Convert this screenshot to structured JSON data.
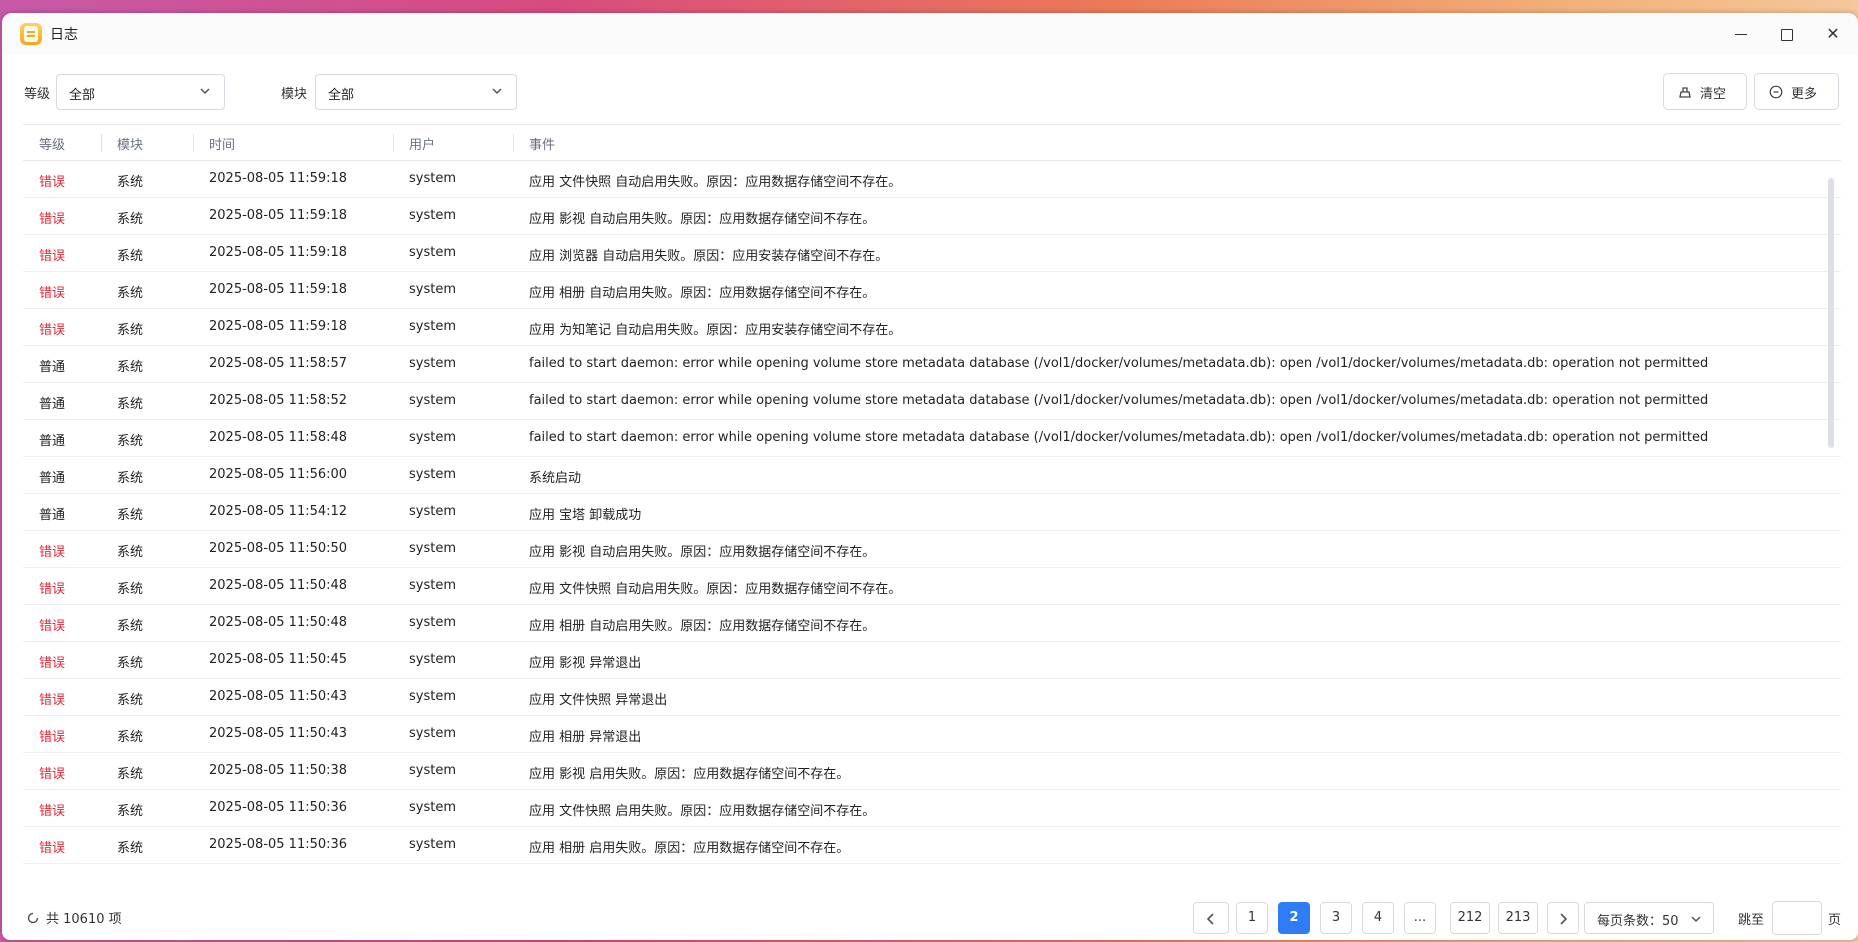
{
  "window": {
    "title": "日志"
  },
  "filters": {
    "level_label": "等级",
    "level_value": "全部",
    "module_label": "模块",
    "module_value": "全部"
  },
  "toolbar": {
    "clear_label": "清空",
    "more_label": "更多"
  },
  "table": {
    "columns": [
      "等级",
      "模块",
      "时间",
      "用户",
      "事件"
    ],
    "rows": [
      {
        "level": "错误",
        "module": "系统",
        "time": "2025-08-05 11:59:18",
        "user": "system",
        "event": "应用 文件快照 自动启用失败。原因：应用数据存储空间不存在。"
      },
      {
        "level": "错误",
        "module": "系统",
        "time": "2025-08-05 11:59:18",
        "user": "system",
        "event": "应用 影视 自动启用失败。原因：应用数据存储空间不存在。"
      },
      {
        "level": "错误",
        "module": "系统",
        "time": "2025-08-05 11:59:18",
        "user": "system",
        "event": "应用 浏览器 自动启用失败。原因：应用安装存储空间不存在。"
      },
      {
        "level": "错误",
        "module": "系统",
        "time": "2025-08-05 11:59:18",
        "user": "system",
        "event": "应用 相册 自动启用失败。原因：应用数据存储空间不存在。"
      },
      {
        "level": "错误",
        "module": "系统",
        "time": "2025-08-05 11:59:18",
        "user": "system",
        "event": "应用 为知笔记 自动启用失败。原因：应用安装存储空间不存在。"
      },
      {
        "level": "普通",
        "module": "系统",
        "time": "2025-08-05 11:58:57",
        "user": "system",
        "event": "failed to start daemon: error while opening volume store metadata database (/vol1/docker/volumes/metadata.db): open /vol1/docker/volumes/metadata.db: operation not permitted"
      },
      {
        "level": "普通",
        "module": "系统",
        "time": "2025-08-05 11:58:52",
        "user": "system",
        "event": "failed to start daemon: error while opening volume store metadata database (/vol1/docker/volumes/metadata.db): open /vol1/docker/volumes/metadata.db: operation not permitted"
      },
      {
        "level": "普通",
        "module": "系统",
        "time": "2025-08-05 11:58:48",
        "user": "system",
        "event": "failed to start daemon: error while opening volume store metadata database (/vol1/docker/volumes/metadata.db): open /vol1/docker/volumes/metadata.db: operation not permitted"
      },
      {
        "level": "普通",
        "module": "系统",
        "time": "2025-08-05 11:56:00",
        "user": "system",
        "event": "系统启动"
      },
      {
        "level": "普通",
        "module": "系统",
        "time": "2025-08-05 11:54:12",
        "user": "system",
        "event": "应用 宝塔 卸载成功"
      },
      {
        "level": "错误",
        "module": "系统",
        "time": "2025-08-05 11:50:50",
        "user": "system",
        "event": "应用 影视 自动启用失败。原因：应用数据存储空间不存在。"
      },
      {
        "level": "错误",
        "module": "系统",
        "time": "2025-08-05 11:50:48",
        "user": "system",
        "event": "应用 文件快照 自动启用失败。原因：应用数据存储空间不存在。"
      },
      {
        "level": "错误",
        "module": "系统",
        "time": "2025-08-05 11:50:48",
        "user": "system",
        "event": "应用 相册 自动启用失败。原因：应用数据存储空间不存在。"
      },
      {
        "level": "错误",
        "module": "系统",
        "time": "2025-08-05 11:50:45",
        "user": "system",
        "event": "应用 影视 异常退出"
      },
      {
        "level": "错误",
        "module": "系统",
        "time": "2025-08-05 11:50:43",
        "user": "system",
        "event": "应用 文件快照 异常退出"
      },
      {
        "level": "错误",
        "module": "系统",
        "time": "2025-08-05 11:50:43",
        "user": "system",
        "event": "应用 相册 异常退出"
      },
      {
        "level": "错误",
        "module": "系统",
        "time": "2025-08-05 11:50:38",
        "user": "system",
        "event": "应用 影视 启用失败。原因：应用数据存储空间不存在。"
      },
      {
        "level": "错误",
        "module": "系统",
        "time": "2025-08-05 11:50:36",
        "user": "system",
        "event": "应用 文件快照 启用失败。原因：应用数据存储空间不存在。"
      },
      {
        "level": "错误",
        "module": "系统",
        "time": "2025-08-05 11:50:36",
        "user": "system",
        "event": "应用 相册 启用失败。原因：应用数据存储空间不存在。"
      }
    ]
  },
  "footer": {
    "total_text": "共 10610 项",
    "pages": [
      "1",
      "2",
      "3",
      "4",
      "...",
      "212",
      "213"
    ],
    "current_page": "2",
    "page_size_text": "每页条数：50",
    "jump_label": "跳至",
    "page_suffix": "页"
  },
  "colors": {
    "error": "#e5283a",
    "accent": "#2f7cf6",
    "app_icon": "#f5a623"
  }
}
